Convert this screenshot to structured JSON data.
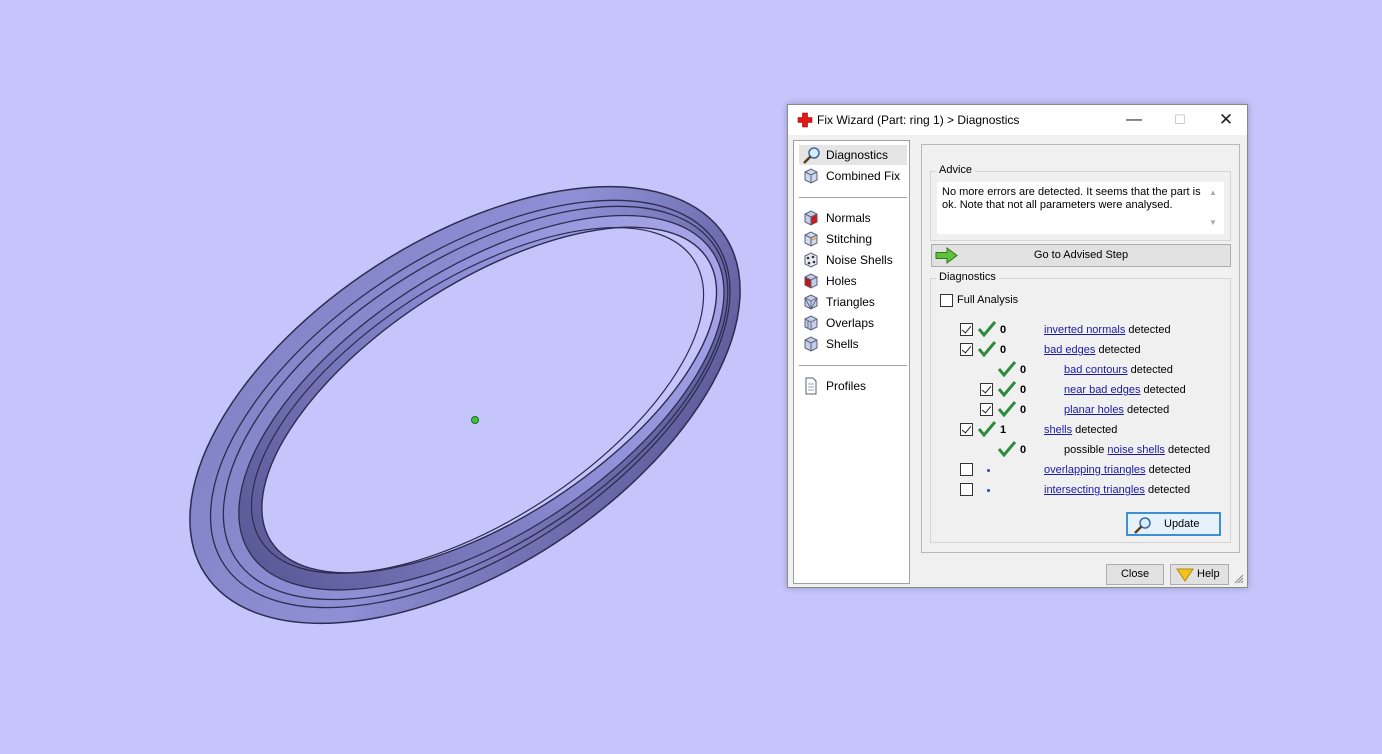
{
  "window": {
    "title": "Fix Wizard (Part: ring 1) > Diagnostics",
    "minimize_glyph": "—",
    "maximize_glyph": "☐",
    "close_glyph": "✕"
  },
  "nav": {
    "items": [
      {
        "label": "Diagnostics",
        "icon": "magnifier-icon"
      },
      {
        "label": "Combined Fix",
        "icon": "cube-icon"
      },
      {
        "label": "Normals",
        "icon": "normals-cube-icon"
      },
      {
        "label": "Stitching",
        "icon": "stitching-cube-icon"
      },
      {
        "label": "Noise Shells",
        "icon": "noise-shells-icon"
      },
      {
        "label": "Holes",
        "icon": "holes-cube-icon"
      },
      {
        "label": "Triangles",
        "icon": "triangles-cube-icon"
      },
      {
        "label": "Overlaps",
        "icon": "overlaps-cube-icon"
      },
      {
        "label": "Shells",
        "icon": "shells-cube-icon"
      },
      {
        "label": "Profiles",
        "icon": "document-icon"
      }
    ]
  },
  "advice": {
    "title": "Advice",
    "text": "No more errors are detected. It seems that the part is ok. Note that not all parameters were analysed."
  },
  "goto_button": {
    "label": "Go to Advised Step"
  },
  "diagnostics": {
    "title": "Diagnostics",
    "full_analysis_label": "Full Analysis",
    "rows": [
      {
        "count": "0",
        "link": "inverted normals",
        "suffix": " detected",
        "prefix": ""
      },
      {
        "count": "0",
        "link": "bad edges",
        "suffix": " detected",
        "prefix": ""
      },
      {
        "count": "0",
        "link": "bad contours",
        "suffix": " detected",
        "prefix": ""
      },
      {
        "count": "0",
        "link": "near bad edges",
        "suffix": " detected",
        "prefix": ""
      },
      {
        "count": "0",
        "link": "planar holes",
        "suffix": " detected",
        "prefix": ""
      },
      {
        "count": "1",
        "link": "shells",
        "suffix": " detected",
        "prefix": ""
      },
      {
        "count": "0",
        "link": "noise shells",
        "suffix": " detected",
        "prefix": "possible "
      },
      {
        "count": "",
        "link": "overlapping triangles",
        "suffix": " detected",
        "prefix": ""
      },
      {
        "count": "",
        "link": "intersecting triangles",
        "suffix": " detected",
        "prefix": ""
      }
    ]
  },
  "update_button": {
    "label": "Update"
  },
  "footer": {
    "close_label": "Close",
    "help_label": "Help"
  },
  "colors": {
    "viewport_bg": "#c5c5fb",
    "ring_fill": "#8a8ad0",
    "link": "#1a1aa8",
    "tick": "#2e8b3e"
  }
}
